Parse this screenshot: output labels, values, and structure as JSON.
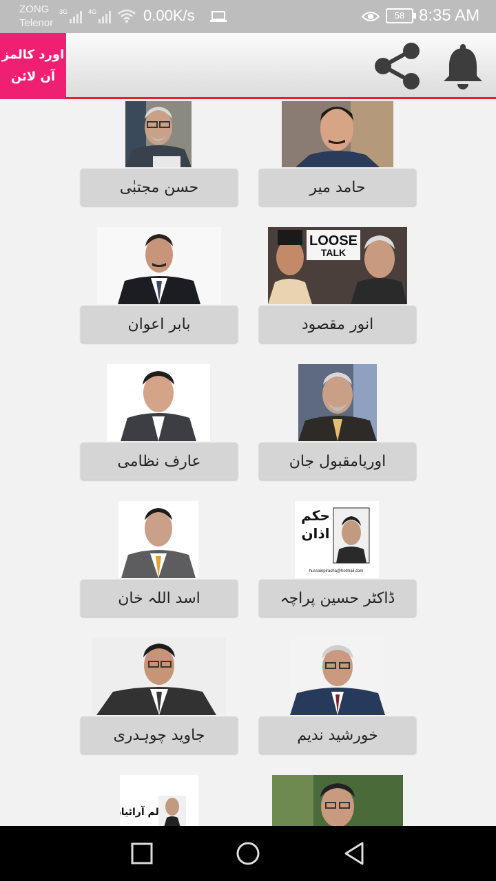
{
  "status_bar": {
    "carrier_1": "ZONG",
    "carrier_2": "Telenor",
    "net_1": "3G",
    "net_2": "4G",
    "speed": "0.00K/s",
    "battery": "58",
    "time": "8:35 AM"
  },
  "app_bar": {
    "logo_line_1": "اورد کالمز",
    "logo_line_2": "آن لائن",
    "share_icon": "share-icon",
    "bell_icon": "bell-icon"
  },
  "columnists": [
    {
      "name": "حامد میر"
    },
    {
      "name": "حسن مجتبٰی"
    },
    {
      "name": "انور مقصود"
    },
    {
      "name": "بابر اعوان"
    },
    {
      "name": "اوریامقبول جان"
    },
    {
      "name": "عارف نظامی"
    },
    {
      "name": "ڈاکٹر حسین پراچہ"
    },
    {
      "name": "اسد اللہ خان"
    },
    {
      "name": "خورشید ندیم"
    },
    {
      "name": "جاوید چوہدری"
    },
    {
      "name": ""
    },
    {
      "name": ""
    }
  ],
  "photo_texts": {
    "loose": "LOOSE",
    "talk": "TALK",
    "hukm": "حکم",
    "azan": "اذان",
    "email": "hussainpiracha@hotmail.com",
    "column_araiyan": "کالم آرائیاں"
  },
  "nav_bar": {
    "recent_icon": "square-icon",
    "home_icon": "circle-icon",
    "back_icon": "triangle-back-icon"
  },
  "colors": {
    "logo_bg": "#ef1f72",
    "accent_line": "#e8202a",
    "button_bg": "#d5d5d5"
  }
}
